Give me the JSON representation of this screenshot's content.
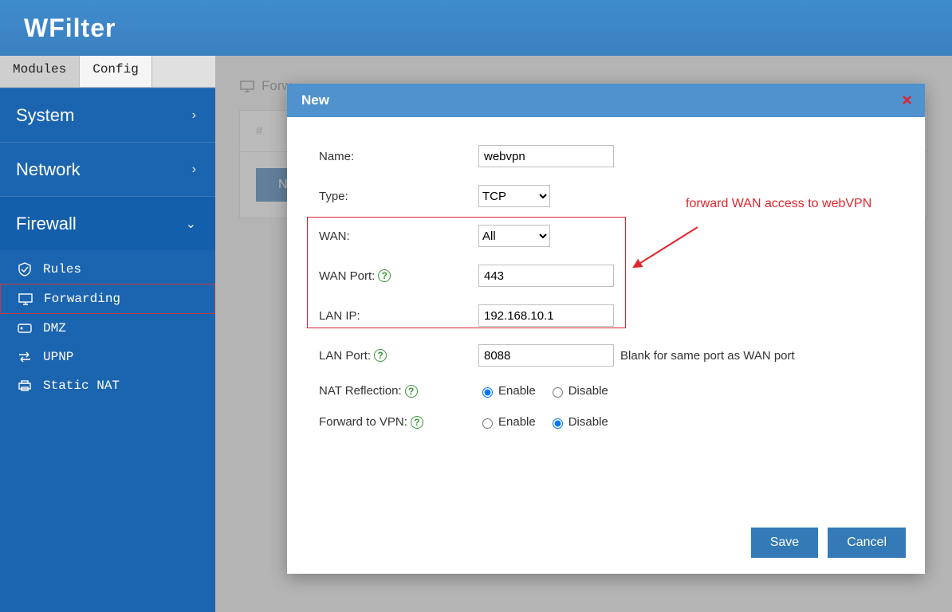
{
  "app": {
    "logo": "WFilter"
  },
  "sidebar": {
    "tabs": [
      {
        "label": "Modules",
        "active": true
      },
      {
        "label": "Config",
        "active": false
      }
    ],
    "sections": [
      {
        "label": "System",
        "expanded": false
      },
      {
        "label": "Network",
        "expanded": false
      },
      {
        "label": "Firewall",
        "expanded": true,
        "items": [
          {
            "label": "Rules",
            "icon": "shield-icon",
            "selected": false
          },
          {
            "label": "Forwarding",
            "icon": "monitor-icon",
            "selected": true
          },
          {
            "label": "DMZ",
            "icon": "server-icon",
            "selected": false
          },
          {
            "label": "UPNP",
            "icon": "arrows-icon",
            "selected": false
          },
          {
            "label": "Static NAT",
            "icon": "printer-icon",
            "selected": false
          }
        ]
      }
    ]
  },
  "main": {
    "breadcrumb_label": "Forw",
    "table_header": "#",
    "new_button": "N"
  },
  "modal": {
    "title": "New",
    "close": "×",
    "rows": {
      "name": {
        "label": "Name:",
        "value": "webvpn"
      },
      "type": {
        "label": "Type:",
        "value": "TCP"
      },
      "wan": {
        "label": "WAN:",
        "value": "All"
      },
      "wan_port": {
        "label": "WAN Port:",
        "value": "443"
      },
      "lan_ip": {
        "label": "LAN IP:",
        "value": "192.168.10.1"
      },
      "lan_port": {
        "label": "LAN Port:",
        "value": "8088",
        "hint": "Blank for same port as WAN port"
      },
      "nat_refl": {
        "label": "NAT Reflection:",
        "enable": "Enable",
        "disable": "Disable",
        "selected": "enable"
      },
      "fwd_vpn": {
        "label": "Forward to VPN:",
        "enable": "Enable",
        "disable": "Disable",
        "selected": "disable"
      }
    },
    "buttons": {
      "save": "Save",
      "cancel": "Cancel"
    },
    "annotation": "forward WAN access to webVPN"
  }
}
